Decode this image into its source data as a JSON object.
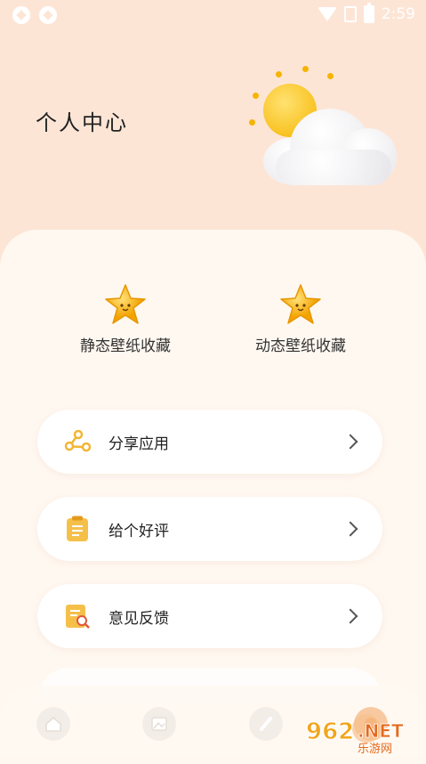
{
  "status_bar": {
    "time": "2:59"
  },
  "header": {
    "title": "个人中心"
  },
  "favorites": [
    {
      "label": "静态壁纸收藏",
      "icon": "star-icon"
    },
    {
      "label": "动态壁纸收藏",
      "icon": "star-icon"
    }
  ],
  "menu": [
    {
      "label": "分享应用",
      "icon": "share-icon"
    },
    {
      "label": "给个好评",
      "icon": "clipboard-icon"
    },
    {
      "label": "意见反馈",
      "icon": "feedback-icon"
    }
  ],
  "tabs": [
    {
      "icon": "home-icon"
    },
    {
      "icon": "image-icon"
    },
    {
      "icon": "pen-icon"
    },
    {
      "icon": "profile-icon"
    }
  ],
  "watermark": {
    "text_main": "962.NET",
    "text_sub": "乐游网"
  },
  "colors": {
    "background": "#fde5d6",
    "panel": "#fff8f1",
    "accent": "#f6c242",
    "text": "#222222"
  }
}
